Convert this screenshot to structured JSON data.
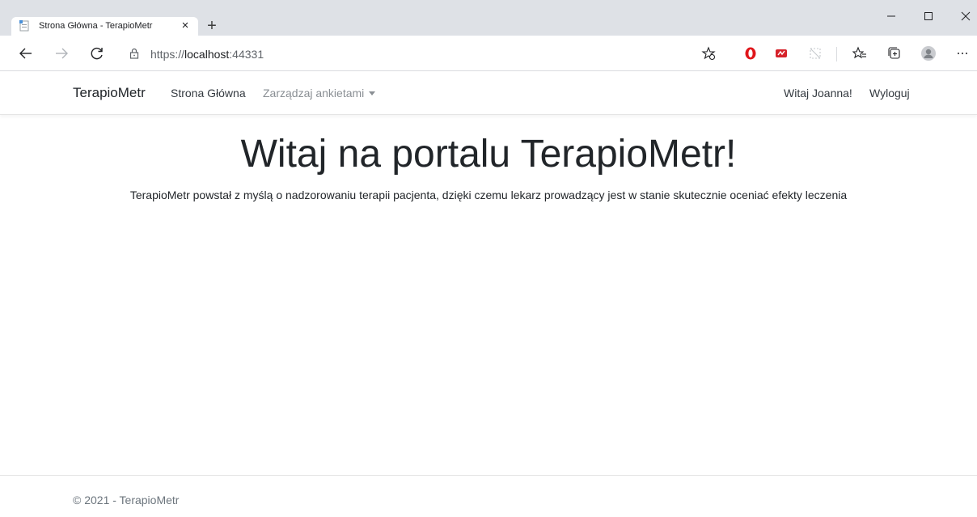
{
  "browser": {
    "tab_title": "Strona Główna - TerapioMetr",
    "tab_close": "×",
    "new_tab": "+",
    "url_scheme": "https://",
    "url_host": "localhost",
    "url_port": ":44331",
    "icons": [
      "back-icon",
      "forward-icon",
      "reload-icon",
      "lock-icon",
      "favorites-add-icon",
      "opera-extension-icon",
      "extension-icon",
      "tracking-disabled-icon",
      "favorites-icon",
      "collections-icon",
      "profile-avatar-icon",
      "more-options-icon"
    ]
  },
  "navbar": {
    "brand": "TerapioMetr",
    "home": "Strona Główna",
    "manage": "Zarządzaj ankietami",
    "greeting": "Witaj Joanna!",
    "logout": "Wyloguj"
  },
  "main": {
    "title": "Witaj na portalu TerapioMetr!",
    "subtitle": "TerapioMetr powstał z myślą o nadzorowaniu terapii pacjenta, dzięki czemu lekarz prowadzący jest w stanie skutecznie oceniać efekty leczenia"
  },
  "footer": {
    "text": "© 2021 - TerapioMetr"
  },
  "colors": {
    "tabbar": "#dee1e6",
    "opera_red": "#e0161b",
    "text": "#212529",
    "muted": "#8a8f94"
  }
}
